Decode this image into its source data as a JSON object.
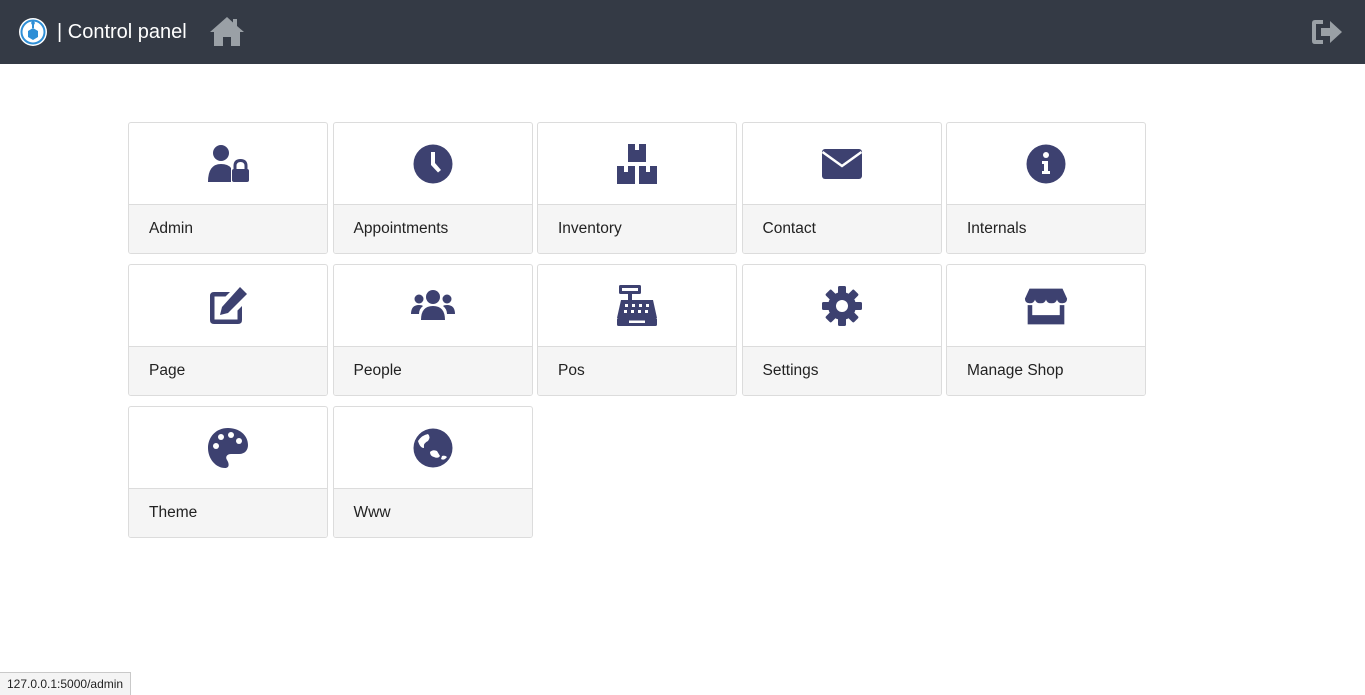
{
  "header": {
    "title": "| Control panel",
    "home_icon": "home-icon",
    "logout_icon": "sign-out-icon",
    "logo_icon": "app-logo"
  },
  "colors": {
    "topbar": "#343a45",
    "icon": "#3d4170",
    "nav_icon": "#9aa0a6"
  },
  "tiles": [
    {
      "label": "Admin",
      "icon": "user-lock-icon"
    },
    {
      "label": "Appointments",
      "icon": "clock-icon"
    },
    {
      "label": "Inventory",
      "icon": "boxes-icon"
    },
    {
      "label": "Contact",
      "icon": "envelope-icon"
    },
    {
      "label": "Internals",
      "icon": "info-circle-icon"
    },
    {
      "label": "Page",
      "icon": "edit-icon"
    },
    {
      "label": "People",
      "icon": "users-icon"
    },
    {
      "label": "Pos",
      "icon": "cash-register-icon"
    },
    {
      "label": "Settings",
      "icon": "cog-icon"
    },
    {
      "label": "Manage Shop",
      "icon": "store-icon"
    },
    {
      "label": "Theme",
      "icon": "palette-icon"
    },
    {
      "label": "Www",
      "icon": "globe-icon"
    }
  ],
  "statusbar": {
    "url": "127.0.0.1:5000/admin"
  }
}
